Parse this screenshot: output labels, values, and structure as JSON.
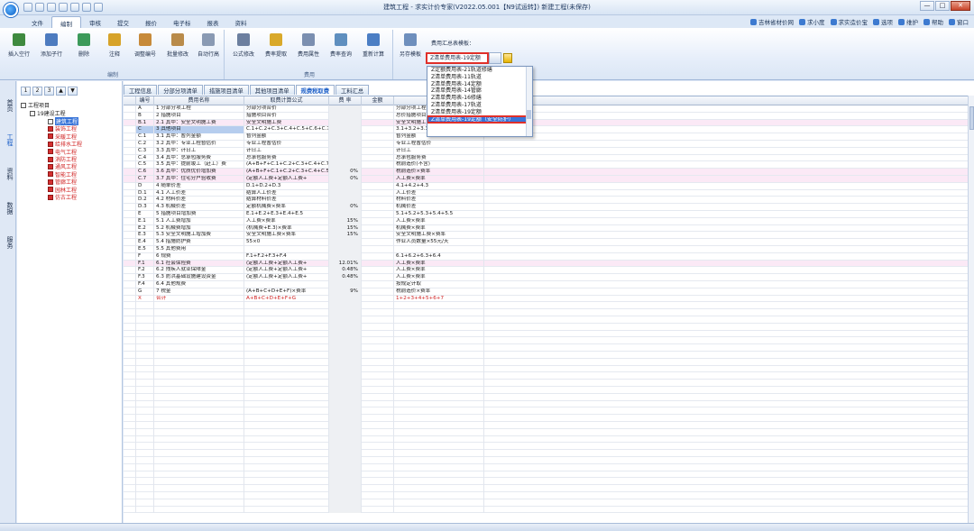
{
  "window": {
    "title": "建筑工程 - 求实计价专家(V2022.05.001【N9试运转】) 新建工程(未保存)",
    "controls": [
      "—",
      "□",
      "✕"
    ]
  },
  "menu": {
    "tabs": [
      "文件",
      "编制",
      "审核",
      "提交",
      "报价",
      "电子标",
      "报表",
      "资料"
    ],
    "active": "编制",
    "right_items": [
      "吉林省材价网",
      "求小度",
      "求实造价宝",
      "选项",
      "维护",
      "帮助",
      "窗口"
    ]
  },
  "ribbon": {
    "group1": {
      "label": "编制",
      "buttons": [
        "插入空行",
        "添加子行",
        "删除",
        "注释",
        "调整编号",
        "批量修改",
        "自动行高"
      ]
    },
    "group2": {
      "label": "费用",
      "buttons": [
        "公式修改",
        "费率提取",
        "费用属性",
        "费率查询",
        "重新计算"
      ]
    },
    "group3": {
      "buttons": [
        "另存模板"
      ],
      "template_label": "费用汇总表模板：",
      "template_value": "Z清单费用表-19定额"
    }
  },
  "dropdown": {
    "items": [
      "Z定额费用表-21轨道修缮",
      "Z清单费用表-11轨道",
      "Z清单费用表-14定额",
      "Z清单费用表-14管廊",
      "Z清单费用表-16修缮",
      "Z清单费用表-17轨道",
      "Z清单费用表-19定额",
      "Z清单费用表-19定额（安全防护）"
    ],
    "selected_index": 7
  },
  "leftnav": [
    "首页",
    "工程",
    "资料",
    "数据",
    "服务"
  ],
  "leftnav_active": 1,
  "tree": {
    "levels": [
      "1",
      "2",
      "3",
      "▲",
      "▼"
    ],
    "root": "工程项目",
    "child": "19建设工程",
    "items": [
      {
        "label": "建筑工程",
        "style": "sel"
      },
      {
        "label": "装饰工程",
        "style": "red"
      },
      {
        "label": "采暖工程",
        "style": "red"
      },
      {
        "label": "给排水工程",
        "style": "red"
      },
      {
        "label": "电气工程",
        "style": "red"
      },
      {
        "label": "消防工程",
        "style": "red"
      },
      {
        "label": "通风工程",
        "style": "red"
      },
      {
        "label": "智能工程",
        "style": "red"
      },
      {
        "label": "管廊工程",
        "style": "red"
      },
      {
        "label": "园林工程",
        "style": "red"
      },
      {
        "label": "仿古工程",
        "style": "red"
      }
    ]
  },
  "subtabs": [
    "工程信息",
    "分部分项清单",
    "措施项目清单",
    "其他项目清单",
    "规费税取费",
    "工料汇总"
  ],
  "subtab_active": 4,
  "grid": {
    "columns": [
      "编号",
      "费用名称",
      "取费计算公式",
      "费 率",
      "金额",
      "说"
    ],
    "rows": [
      {
        "code": "A",
        "name": "1 分部分项工程",
        "formula": "分部分项合价",
        "rate": "",
        "desc": "分部分项工程",
        "style": ""
      },
      {
        "code": "B",
        "name": "2 措施项目",
        "formula": "措施项目合价",
        "rate": "",
        "desc": "总价措施项目",
        "style": ""
      },
      {
        "code": "B.1",
        "name": "2.1 其中：安全文明施工费",
        "formula": "安全文明施工费",
        "rate": "",
        "desc": "安全文明施工",
        "style": "pink"
      },
      {
        "code": "C",
        "name": "3 其他项目",
        "formula": "C.1+C.2+C.3+C.4+C.5+C.6+C.7",
        "rate": "",
        "desc": "3.1+3.2+3.3",
        "style": "hl"
      },
      {
        "code": "C.1",
        "name": "3.1 其中：暂列金额",
        "formula": "暂列金额",
        "rate": "",
        "desc": "暂列金额",
        "style": ""
      },
      {
        "code": "C.2",
        "name": "3.2 其中：专业工程暂估价",
        "formula": "专业工程暂估价",
        "rate": "",
        "desc": "专业工程暂估价",
        "style": ""
      },
      {
        "code": "C.3",
        "name": "3.3 其中：计日工",
        "formula": "计日工",
        "rate": "",
        "desc": "计日工",
        "style": ""
      },
      {
        "code": "C.4",
        "name": "3.4 其中：总承包服务费",
        "formula": "总承包服务费",
        "rate": "",
        "desc": "总承包服务费",
        "style": ""
      },
      {
        "code": "C.5",
        "name": "3.5 其中：提前竣工（赶工）费",
        "formula": "(A+B+F+C.1+C.2+C.3+C.4+C.7",
        "rate": "",
        "desc": "税前造价(不含)",
        "style": ""
      },
      {
        "code": "C.6",
        "name": "3.6 其中：优质优价增加费",
        "formula": "(A+B+F+C.1+C.2+C.3+C.4+C.5",
        "rate": "0%",
        "desc": "税前造价×费率",
        "style": "pink"
      },
      {
        "code": "C.7",
        "name": "3.7 其中：住宅分户验收费",
        "formula": "(定额人工费+定额人工费+",
        "rate": "0%",
        "desc": "人工费×费率",
        "style": "pink"
      },
      {
        "code": "D",
        "name": "4 随单价差",
        "formula": "D.1+D.2+D.3",
        "rate": "",
        "desc": "4.1+4.2+4.3",
        "style": ""
      },
      {
        "code": "D.1",
        "name": "4.1 人工价差",
        "formula": "结算人工价差",
        "rate": "",
        "desc": "人工价差",
        "style": ""
      },
      {
        "code": "D.2",
        "name": "4.2 材料价差",
        "formula": "结算材料价差",
        "rate": "",
        "desc": "材料价差",
        "style": ""
      },
      {
        "code": "D.3",
        "name": "4.3 机械价差",
        "formula": "定额机械费×费率",
        "rate": "0%",
        "desc": "机械价差",
        "style": ""
      },
      {
        "code": "E",
        "name": "5 措施项目增加费",
        "formula": "E.1+E.2+E.3+E.4+E.5",
        "rate": "",
        "desc": "5.1+5.2+5.3+5.4+5.5",
        "style": ""
      },
      {
        "code": "E.1",
        "name": "5.1 人工费增加",
        "formula": "人工费×费率",
        "rate": "15%",
        "desc": "人工费×费率",
        "style": ""
      },
      {
        "code": "E.2",
        "name": "5.2 机械费增加",
        "formula": "(机械费+E.3)×费率",
        "rate": "15%",
        "desc": "机械费×费率",
        "style": ""
      },
      {
        "code": "E.3",
        "name": "5.3 安全文明施工增加费",
        "formula": "安全文明施工费×费率",
        "rate": "15%",
        "desc": "安全文明施工费×费率",
        "style": ""
      },
      {
        "code": "E.4",
        "name": "5.4 措施防护费",
        "formula": "55×0",
        "rate": "",
        "desc": "作业人员数量×55元/天",
        "style": ""
      },
      {
        "code": "E.5",
        "name": "5.5 其他费用",
        "formula": "",
        "rate": "",
        "desc": "",
        "style": ""
      },
      {
        "code": "F",
        "name": "6 规费",
        "formula": "F.1+F.2+F.3+F.4",
        "rate": "",
        "desc": "6.1+6.2+6.3+6.4",
        "style": ""
      },
      {
        "code": "F.1",
        "name": "6.1 社会保险费",
        "formula": "(定额人工费+定额人工费+",
        "rate": "12.01%",
        "desc": "人工费×费率",
        "style": "pink"
      },
      {
        "code": "F.2",
        "name": "6.2 残疾人就业保障金",
        "formula": "(定额人工费+定额人工费+",
        "rate": "0.48%",
        "desc": "人工费×费率",
        "style": ""
      },
      {
        "code": "F.3",
        "name": "6.3 防洪基础设施建设资金",
        "formula": "(定额人工费+定额人工费+",
        "rate": "0.48%",
        "desc": "人工费×费率",
        "style": ""
      },
      {
        "code": "F.4",
        "name": "6.4 其他规费",
        "formula": "",
        "rate": "",
        "desc": "按规定计取",
        "style": ""
      },
      {
        "code": "G",
        "name": "7 税金",
        "formula": "(A+B+C+D+E+F)×费率",
        "rate": "9%",
        "desc": "税前造价×费率",
        "style": ""
      },
      {
        "code": "X",
        "name": "合计",
        "formula": "A+B+C+D+E+F+G",
        "rate": "",
        "desc": "1+2+3+4+5+6+7",
        "style": "red"
      }
    ]
  }
}
